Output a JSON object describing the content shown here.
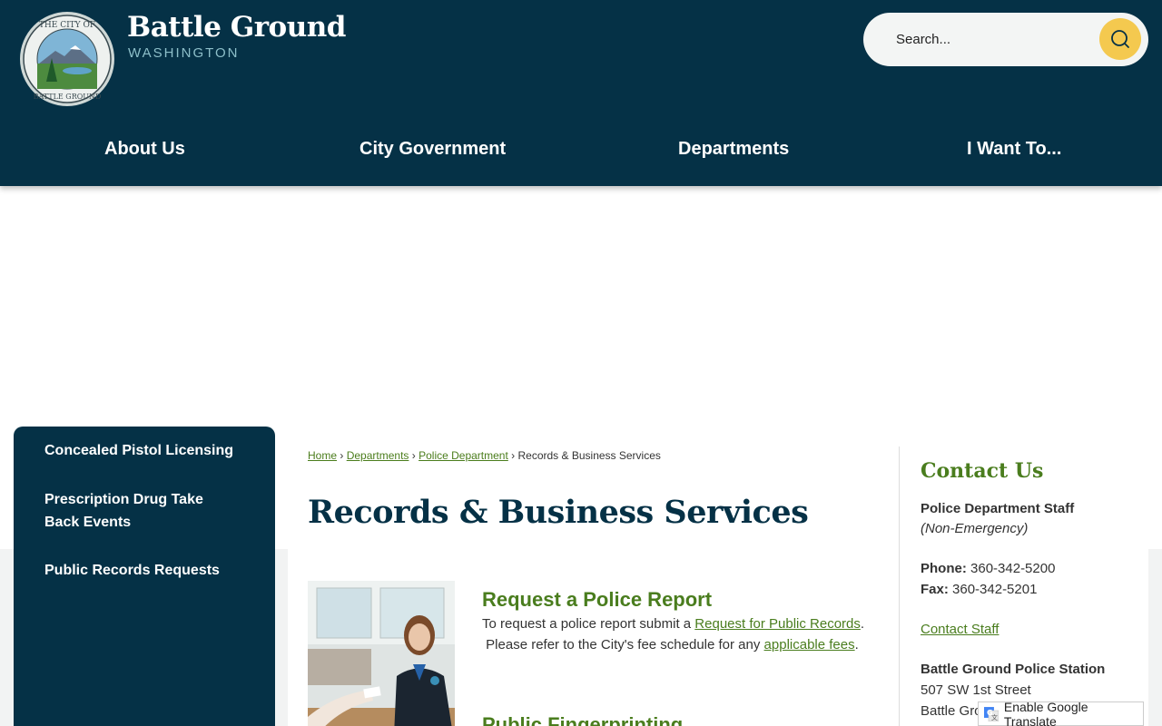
{
  "header": {
    "brand_name": "Battle Ground",
    "brand_sub": "WASHINGTON",
    "seal_text_top": "THE CITY OF",
    "seal_text_bottom": "BATTLE GROUND"
  },
  "search": {
    "placeholder": "Search..."
  },
  "nav": {
    "items": [
      "About Us",
      "City Government",
      "Departments",
      "I Want To..."
    ]
  },
  "sidebar": {
    "items": [
      "Concealed Pistol Licensing",
      "Prescription Drug Take Back Events",
      "Public Records Requests"
    ]
  },
  "breadcrumb": {
    "home": "Home",
    "departments": "Departments",
    "police": "Police Department",
    "current": "Records & Business Services",
    "separator": "›"
  },
  "main": {
    "title": "Records & Business Services",
    "section1": {
      "title": "Request a Police Report",
      "text1": "To request a police report submit a",
      "link1": "Request for Public Records",
      "text1_end": ".",
      "text2": "Please refer to the City's fee schedule for any",
      "link2": "applicable fees",
      "text2_end": "."
    },
    "section2": {
      "title": "Public Fingerprinting"
    }
  },
  "contact": {
    "title": "Contact Us",
    "staff": "Police Department Staff",
    "staff_note": "(Non-Emergency)",
    "phone_label": "Phone:",
    "phone": "360-342-5200",
    "fax_label": "Fax:",
    "fax": "360-342-5201",
    "staff_link": "Contact Staff",
    "station": "Battle Ground Police Station",
    "street": "507 SW 1st Street",
    "city": "Battle Ground"
  },
  "translate": {
    "label": "Enable Google Translate"
  },
  "colors": {
    "header_bg": "#053146",
    "accent_green": "#4a7d1e",
    "search_button": "#f4c94f"
  }
}
